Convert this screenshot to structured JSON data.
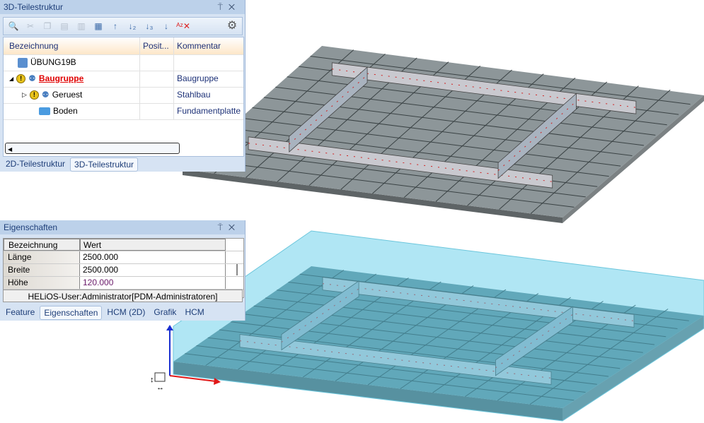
{
  "tree_panel": {
    "title": "3D-Teilestruktur",
    "pin": "⍑",
    "close": "✕",
    "columns": [
      "Bezeichnung",
      "Posit...",
      "Kommentar"
    ],
    "rows": [
      {
        "name": "ÜBUNG19B",
        "pos": "",
        "comment": ""
      },
      {
        "name": "Baugruppe",
        "pos": "",
        "comment": "Baugruppe"
      },
      {
        "name": "Geruest",
        "pos": "",
        "comment": "Stahlbau"
      },
      {
        "name": "Boden",
        "pos": "",
        "comment": "Fundamentplatte"
      }
    ],
    "tabs": [
      "2D-Teilestruktur",
      "3D-Teilestruktur"
    ]
  },
  "props_panel": {
    "title": "Eigenschaften",
    "pin": "⍑",
    "close": "✕",
    "columns": [
      "Bezeichnung",
      "Wert"
    ],
    "rows": [
      {
        "k": "Länge",
        "v": "2500.000"
      },
      {
        "k": "Breite",
        "v": "2500.000"
      },
      {
        "k": "Höhe",
        "v": "120.000"
      }
    ],
    "status": "HELiOS-User:Administrator[PDM-Administratoren]",
    "tabs": [
      "Feature",
      "Eigenschaften",
      "HCM (2D)",
      "Grafik",
      "HCM"
    ]
  },
  "colors": {
    "accent": "#1e3e78",
    "selected": "#e00000"
  }
}
